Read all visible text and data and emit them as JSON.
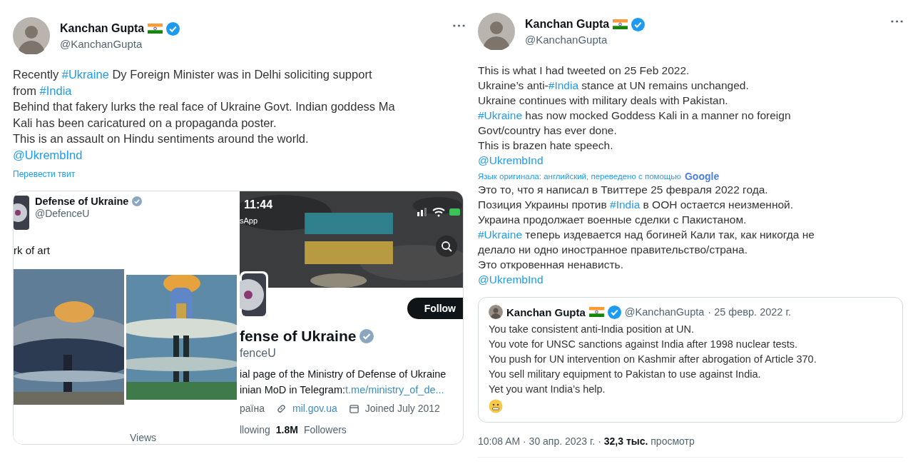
{
  "left_tweet": {
    "author": {
      "name": "Kanchan Gupta",
      "handle": "@KanchanGupta"
    },
    "lines": [
      [
        {
          "kind": "text",
          "text": "Recently "
        },
        {
          "kind": "hashtag",
          "text": "#Ukraine"
        },
        {
          "kind": "text",
          "text": " Dy Foreign Minister was in Delhi soliciting support"
        }
      ],
      [
        {
          "kind": "text",
          "text": "from "
        },
        {
          "kind": "hashtag",
          "text": "#India"
        }
      ],
      [
        {
          "kind": "text",
          "text": "Behind that fakery lurks the real face of Ukraine Govt. Indian goddess Ma"
        }
      ],
      [
        {
          "kind": "text",
          "text": "Kali has been caricatured on a propaganda poster."
        }
      ],
      [
        {
          "kind": "text",
          "text": "This is an assault on Hindu sentiments around the world."
        }
      ],
      [
        {
          "kind": "mention",
          "text": "@UkrembInd"
        }
      ]
    ],
    "translate_link": "Перевести твит",
    "media": {
      "embedded_tweet": {
        "name": "Defense of Ukraine",
        "handle": "@DefenceU",
        "text": "rk of art",
        "views": "Views"
      },
      "profile": {
        "time": "11:44",
        "app": "sApp",
        "follow": "Follow",
        "name": "fense of Ukraine",
        "handle": "fenceU",
        "bio": [
          "ial page of the Ministry of Defense of Ukraine",
          "inian MoD in Telegram: "
        ],
        "bio_link": "t.me/ministry_of_de...",
        "location": "раїна",
        "website": "mil.gov.ua",
        "joined": "Joined July 2012",
        "following": "llowing",
        "followers_count": "1.8M",
        "followers_label": "Followers"
      }
    }
  },
  "right_tweet": {
    "author": {
      "name": "Kanchan Gupta",
      "handle": "@KanchanGupta"
    },
    "lines": [
      [
        {
          "kind": "text",
          "text": "This is what I had tweeted on 25 Feb 2022."
        }
      ],
      [
        {
          "kind": "text",
          "text": "Ukraine’s anti-"
        },
        {
          "kind": "hashtag",
          "text": "#India"
        },
        {
          "kind": "text",
          "text": " stance at UN remains unchanged."
        }
      ],
      [
        {
          "kind": "text",
          "text": "Ukraine continues with military deals with Pakistan."
        }
      ],
      [
        {
          "kind": "hashtag",
          "text": "#Ukraine"
        },
        {
          "kind": "text",
          "text": " has now mocked Goddess Kali in a manner no foreign"
        }
      ],
      [
        {
          "kind": "text",
          "text": "Govt/country has ever done."
        }
      ],
      [
        {
          "kind": "text",
          "text": "This is brazen hate speech."
        }
      ],
      [
        {
          "kind": "mention",
          "text": "@UkrembInd"
        }
      ]
    ],
    "translation_note": {
      "text": "Язык оригинала: английский, переведено с помощью",
      "logo": "Google"
    },
    "translated_lines": [
      [
        {
          "kind": "text",
          "text": "Это то, что я написал в Твиттере 25 февраля 2022 года."
        }
      ],
      [
        {
          "kind": "text",
          "text": "Позиция Украины против "
        },
        {
          "kind": "hashtag",
          "text": "#India"
        },
        {
          "kind": "text",
          "text": " в ООН остается неизменной."
        }
      ],
      [
        {
          "kind": "text",
          "text": "Украина продолжает военные сделки с Пакистаном."
        }
      ],
      [
        {
          "kind": "hashtag",
          "text": "#Ukraine"
        },
        {
          "kind": "text",
          "text": " теперь издевается над богиней Кали так, как никогда не"
        }
      ],
      [
        {
          "kind": "text",
          "text": "делало ни одно иностранное правительство/страна."
        }
      ],
      [
        {
          "kind": "text",
          "text": "Это откровенная ненависть."
        }
      ],
      [
        {
          "kind": "mention",
          "text": "@UkrembInd"
        }
      ]
    ],
    "quoted_tweet": {
      "name": "Kanchan Gupta",
      "handle": "@KanchanGupta",
      "date": "· 25 февр. 2022 г.",
      "lines": [
        "You take consistent anti-India position at UN.",
        "You vote for UNSC sanctions against India after 1998 nuclear tests.",
        "You push for UN intervention on Kashmir after abrogation of Article 370.",
        "You sell military equipment to Pakistan to use against India.",
        "Yet you want India’s help."
      ]
    },
    "footer": "10:08 AM · 30 апр. 2023 г. · **32,3 тыс.** просмотр"
  }
}
